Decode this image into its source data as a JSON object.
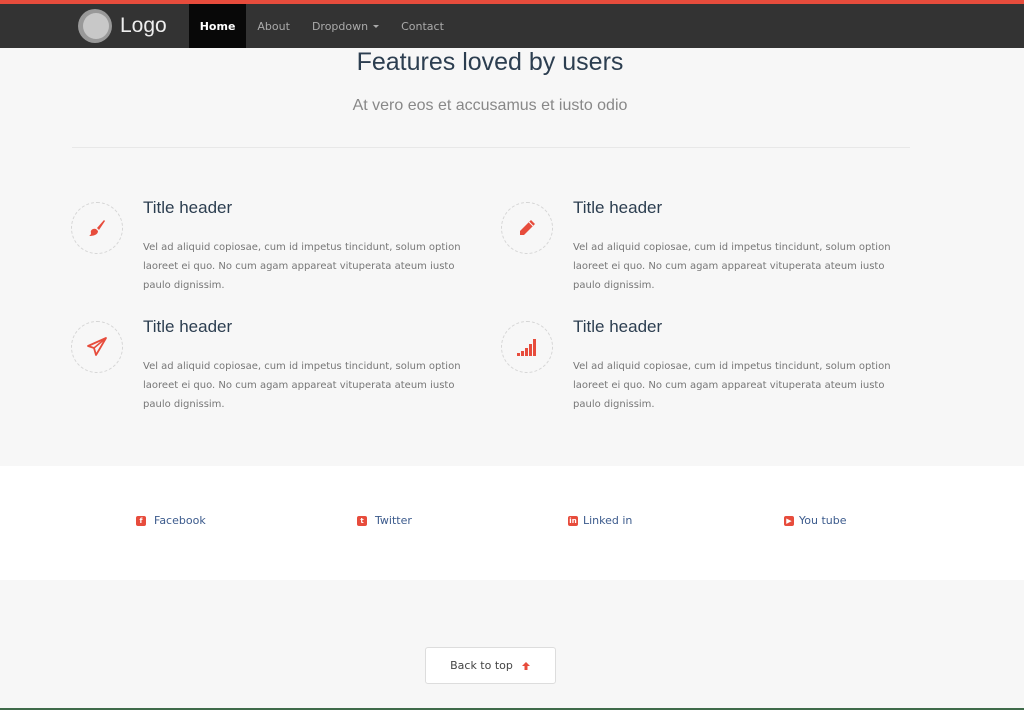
{
  "navbar": {
    "brand": "Logo",
    "accent_color": "#e74c3c",
    "items": [
      {
        "label": "Home",
        "active": true
      },
      {
        "label": "About",
        "active": false
      },
      {
        "label": "Dropdown",
        "active": false,
        "has_caret": true
      },
      {
        "label": "Contact",
        "active": false
      }
    ]
  },
  "features": {
    "title": "Features loved by users",
    "subtitle": "At vero eos et accusamus et iusto odio",
    "items": [
      {
        "icon": "paintbrush-icon",
        "title": "Title header",
        "text": "Vel ad aliquid copiosae, cum id impetus tincidunt, solum option laoreet ei quo. No cum agam appareat vituperata ateum iusto paulo dignissim."
      },
      {
        "icon": "pencil-icon",
        "title": "Title header",
        "text": "Vel ad aliquid copiosae, cum id impetus tincidunt, solum option laoreet ei quo. No cum agam appareat vituperata ateum iusto paulo dignissim."
      },
      {
        "icon": "paper-plane-icon",
        "title": "Title header",
        "text": "Vel ad aliquid copiosae, cum id impetus tincidunt, solum option laoreet ei quo. No cum agam appareat vituperata ateum iusto paulo dignissim."
      },
      {
        "icon": "signal-bars-icon",
        "title": "Title header",
        "text": "Vel ad aliquid copiosae, cum id impetus tincidunt, solum option laoreet ei quo. No cum agam appareat vituperata ateum iusto paulo dignissim."
      }
    ]
  },
  "social": {
    "links": [
      {
        "icon": "facebook-icon",
        "glyph": "f",
        "label": "Facebook"
      },
      {
        "icon": "twitter-icon",
        "glyph": "t",
        "label": "Twitter"
      },
      {
        "icon": "linkedin-icon",
        "glyph": "in",
        "label": "Linked in"
      },
      {
        "icon": "youtube-icon",
        "glyph": "▶",
        "label": "You tube"
      }
    ]
  },
  "footer": {
    "back_to_top": "Back to top"
  }
}
